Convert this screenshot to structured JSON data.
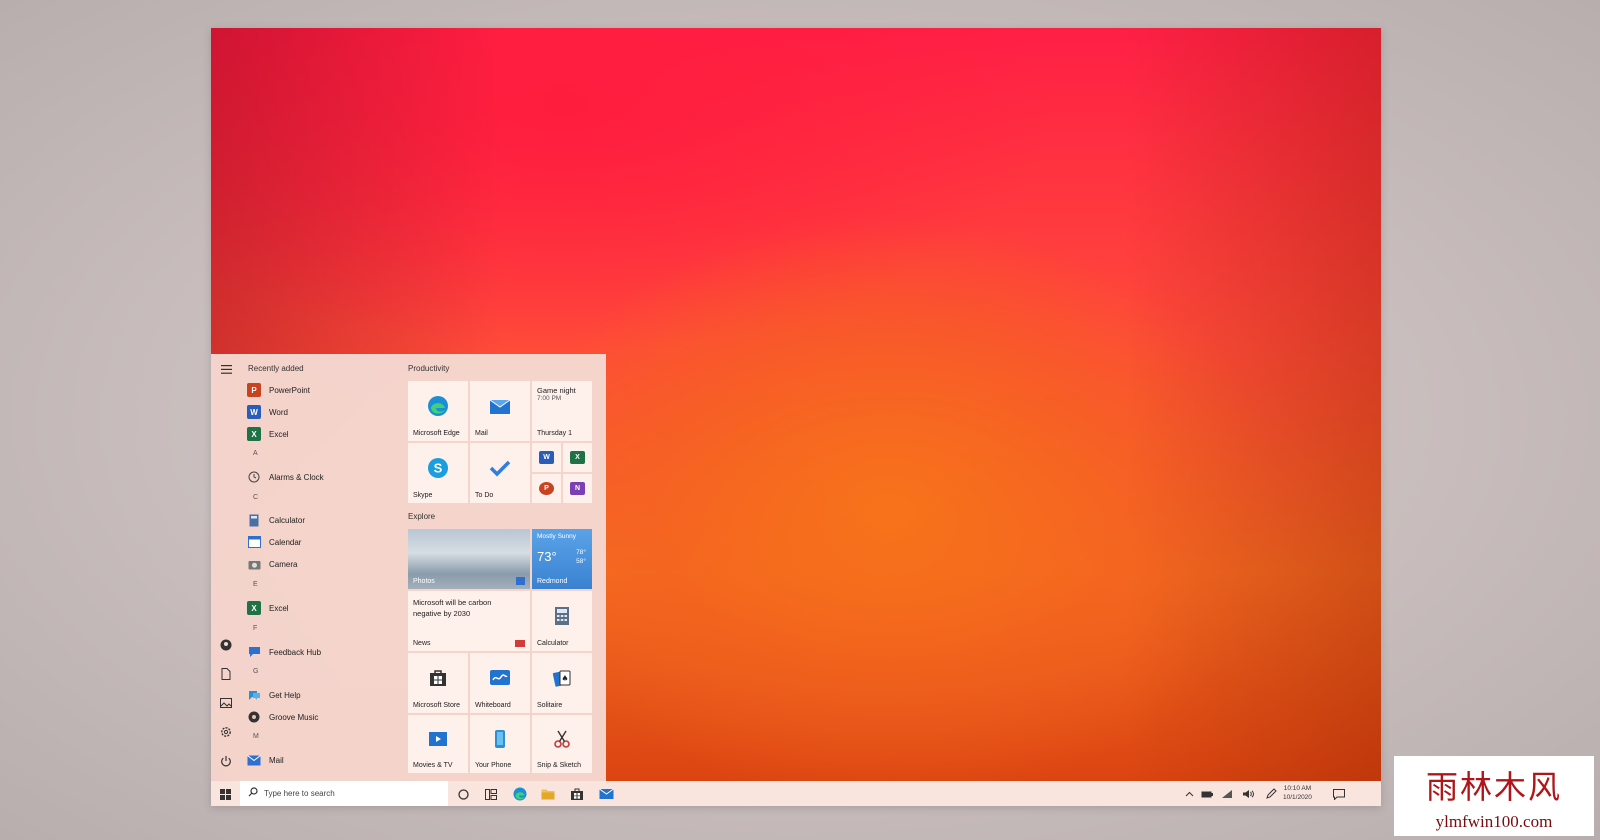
{
  "start_menu": {
    "rail_icons": [
      "hamburger-icon",
      "user-icon",
      "documents-icon",
      "pictures-icon",
      "settings-icon",
      "power-icon"
    ],
    "recently_added_label": "Recently added",
    "apps": [
      {
        "label": "PowerPoint",
        "color": "#c8431f"
      },
      {
        "label": "Word",
        "color": "#2b5cb8"
      },
      {
        "label": "Excel",
        "color": "#1e7245"
      },
      {
        "letter": "A"
      },
      {
        "label": "Alarms & Clock",
        "color": "#555555"
      },
      {
        "letter": "C"
      },
      {
        "label": "Calculator",
        "color": "#4a6fa5"
      },
      {
        "label": "Calendar",
        "color": "#2e6fd0"
      },
      {
        "label": "Camera",
        "color": "#6a6a6a"
      },
      {
        "letter": "E"
      },
      {
        "label": "Excel",
        "color": "#1e7245"
      },
      {
        "letter": "F"
      },
      {
        "label": "Feedback Hub",
        "color": "#2e6fd0"
      },
      {
        "letter": "G"
      },
      {
        "label": "Get Help",
        "color": "#2e8fd0"
      },
      {
        "label": "Groove Music",
        "color": "#333333"
      },
      {
        "letter": "M"
      },
      {
        "label": "Mail",
        "color": "#2e6fd0"
      }
    ],
    "sections": {
      "productivity": "Productivity",
      "explore": "Explore"
    },
    "tiles": {
      "edge": "Microsoft Edge",
      "mail": "Mail",
      "calendar_event": "Game night",
      "calendar_time": "7:00 PM",
      "calendar_day": "Thursday 1",
      "skype": "Skype",
      "todo": "To Do",
      "photos": "Photos",
      "weather_cond": "Mostly Sunny",
      "weather_temp": "73°",
      "weather_hi": "78°",
      "weather_lo": "58°",
      "weather_city": "Redmond",
      "news_headline": "Microsoft will be carbon negative by 2030",
      "news": "News",
      "calculator": "Calculator",
      "store": "Microsoft Store",
      "whiteboard": "Whiteboard",
      "solitaire": "Solitaire",
      "movies": "Movies & TV",
      "phone": "Your Phone",
      "snip": "Snip & Sketch"
    }
  },
  "taskbar": {
    "search_placeholder": "Type here to search",
    "time": "10:10 AM",
    "date": "10/1/2020"
  },
  "watermark": {
    "cn": "雨林木风",
    "en": "ylmfwin100.com"
  },
  "colors": {
    "accent": "#e8442c",
    "start_bg": "#f5dad2"
  }
}
